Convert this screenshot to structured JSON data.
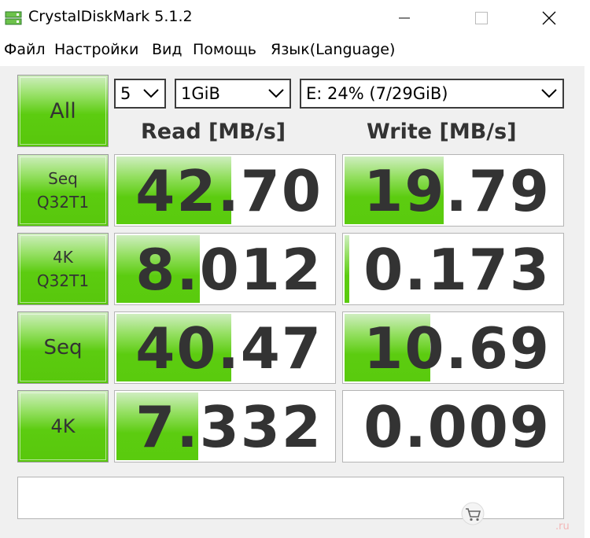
{
  "window": {
    "title": "CrystalDiskMark 5.1.2"
  },
  "menu": [
    "Файл",
    "Настройки",
    "Вид",
    "Помощь",
    "Язык(Language)"
  ],
  "controls": {
    "all_label": "All",
    "count": "5",
    "size": "1GiB",
    "drive": "E: 24% (7/29GiB)"
  },
  "headers": {
    "read": "Read [MB/s]",
    "write": "Write [MB/s]"
  },
  "tests": [
    {
      "label_line1": "Seq",
      "label_line2": "Q32T1",
      "read": "42.70",
      "write": "19.79",
      "read_fill": 0.52,
      "write_fill": 0.45
    },
    {
      "label_line1": "4K",
      "label_line2": "Q32T1",
      "read": "8.012",
      "write": "0.173",
      "read_fill": 0.38,
      "write_fill": 0.02
    },
    {
      "label_line1": "Seq",
      "label_line2": "",
      "read": "40.47",
      "write": "10.69",
      "read_fill": 0.52,
      "write_fill": 0.39
    },
    {
      "label_line1": "4K",
      "label_line2": "",
      "read": "7.332",
      "write": "0.009",
      "read_fill": 0.37,
      "write_fill": 0.0
    }
  ],
  "comment": "",
  "watermark": ".ru",
  "colors": {
    "bar_green": "#5ccc10",
    "text": "#333333"
  }
}
